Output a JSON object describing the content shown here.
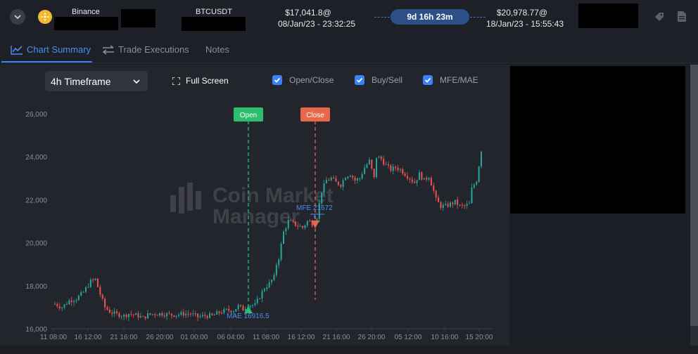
{
  "header": {
    "exchange": "Binance",
    "symbol": "BTCUSDT",
    "entry_price": "$17,041.8@",
    "entry_time": "08/Jan/23 - 23:32:25",
    "duration": "9d 16h 23m",
    "exit_price": "$20,978.77@",
    "exit_time": "18/Jan/23 - 15:55:43"
  },
  "tabs": [
    {
      "label": "Chart Summary",
      "active": true
    },
    {
      "label": "Trade Executions",
      "active": false
    },
    {
      "label": "Notes",
      "active": false
    }
  ],
  "controls": {
    "timeframe": "4h Timeframe",
    "full_screen": "Full Screen",
    "checkboxes": [
      {
        "label": "Open/Close",
        "checked": true
      },
      {
        "label": "Buy/Sell",
        "checked": true
      },
      {
        "label": "MFE/MAE",
        "checked": true
      }
    ]
  },
  "watermark": {
    "line1": "Coin Market",
    "line2": "Manager"
  },
  "colors": {
    "accent": "#3b82f6",
    "up": "#26a69a",
    "down": "#ef5350",
    "open_marker": "#2ebd6e",
    "close_marker": "#e8694a"
  },
  "chart_data": {
    "type": "candlestick",
    "yticks": [
      "26,000",
      "24,000",
      "22,000",
      "20,000",
      "18,000",
      "16,000"
    ],
    "ylim": [
      16000,
      26400
    ],
    "xticks": [
      "11 08:00",
      "16 12:00",
      "21 16:00",
      "26 20:00",
      "01 00:00",
      "06 04:00",
      "11 08:00",
      "16 12:00",
      "21 16:00",
      "26 20:00",
      "05 12:00",
      "10 16:00",
      "15 20:00"
    ],
    "annotations": {
      "open_label": "Open",
      "close_label": "Close",
      "mfe_label": "MFE 21672",
      "mae_label": "MAE 16916.5"
    },
    "price_path": [
      [
        0,
        17150
      ],
      [
        3,
        17000
      ],
      [
        6,
        17300
      ],
      [
        9,
        17400
      ],
      [
        12,
        17700
      ],
      [
        15,
        18200
      ],
      [
        17,
        18300
      ],
      [
        19,
        17600
      ],
      [
        21,
        17000
      ],
      [
        23,
        16800
      ],
      [
        25,
        16700
      ],
      [
        27,
        16650
      ],
      [
        29,
        16600
      ],
      [
        31,
        16700
      ],
      [
        33,
        16650
      ],
      [
        35,
        16600
      ],
      [
        37,
        16500
      ],
      [
        39,
        16650
      ],
      [
        42,
        16700
      ],
      [
        45,
        16700
      ],
      [
        48,
        16650
      ],
      [
        51,
        16650
      ],
      [
        54,
        16700
      ],
      [
        57,
        16700
      ],
      [
        60,
        16550
      ],
      [
        63,
        16600
      ],
      [
        66,
        16600
      ],
      [
        69,
        16750
      ],
      [
        72,
        16850
      ],
      [
        75,
        16850
      ],
      [
        77,
        17050
      ],
      [
        79,
        16900
      ],
      [
        81,
        17100
      ],
      [
        84,
        17100
      ],
      [
        86,
        17500
      ],
      [
        88,
        17900
      ],
      [
        90,
        18100
      ],
      [
        92,
        18400
      ],
      [
        93,
        19000
      ],
      [
        94,
        19300
      ],
      [
        95,
        19900
      ],
      [
        96,
        20500
      ],
      [
        98,
        21000
      ],
      [
        100,
        20900
      ],
      [
        102,
        20800
      ],
      [
        104,
        20700
      ],
      [
        106,
        21000
      ],
      [
        108,
        20900
      ],
      [
        110,
        21200
      ],
      [
        112,
        22400
      ],
      [
        114,
        22900
      ],
      [
        116,
        23000
      ],
      [
        118,
        22800
      ],
      [
        120,
        22700
      ],
      [
        122,
        23100
      ],
      [
        124,
        23200
      ],
      [
        126,
        22900
      ],
      [
        128,
        23000
      ],
      [
        130,
        23500
      ],
      [
        132,
        23800
      ],
      [
        134,
        23000
      ],
      [
        135,
        24000
      ],
      [
        137,
        23900
      ],
      [
        139,
        23600
      ],
      [
        141,
        23400
      ],
      [
        143,
        23500
      ],
      [
        145,
        23400
      ],
      [
        147,
        23200
      ],
      [
        149,
        23000
      ],
      [
        151,
        22800
      ],
      [
        153,
        23200
      ],
      [
        155,
        22900
      ],
      [
        157,
        23100
      ],
      [
        159,
        22400
      ],
      [
        160,
        22000
      ],
      [
        162,
        21700
      ],
      [
        164,
        21700
      ],
      [
        166,
        21800
      ],
      [
        168,
        21900
      ],
      [
        170,
        21700
      ],
      [
        172,
        21700
      ],
      [
        174,
        21800
      ],
      [
        175,
        22500
      ],
      [
        177,
        22900
      ],
      [
        179,
        24300
      ]
    ]
  }
}
